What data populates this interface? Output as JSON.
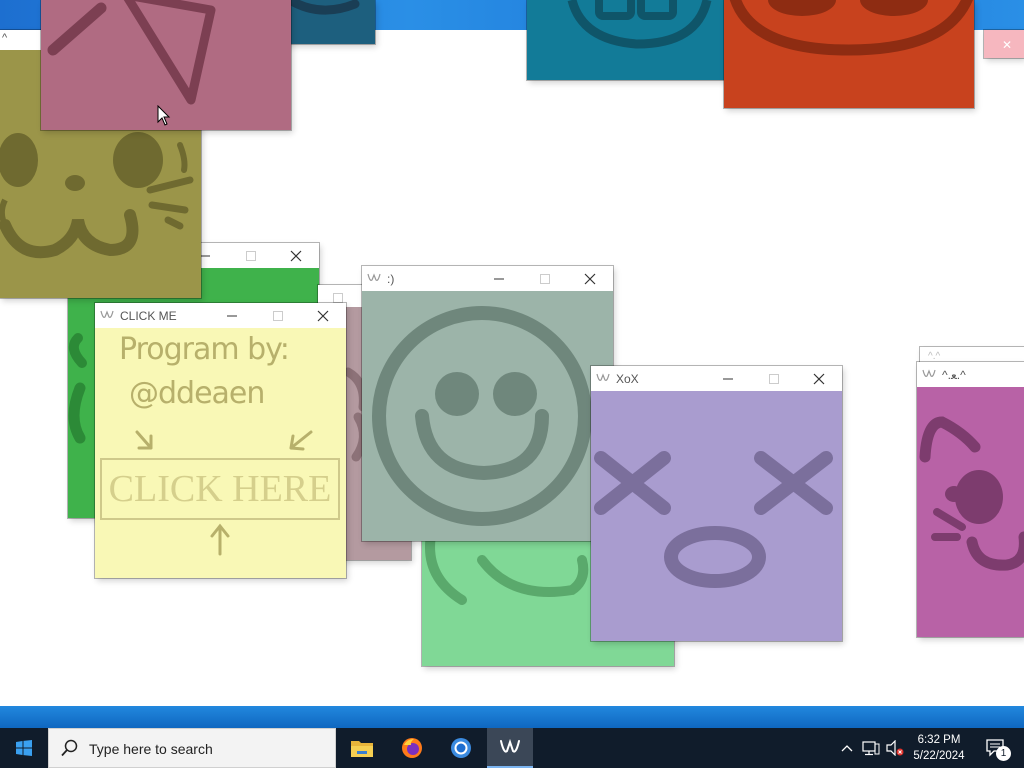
{
  "windows": {
    "click_me": {
      "title": "CLICK ME",
      "credit_line1": "Program by:",
      "credit_line2": "@ddeaen",
      "button_label": "CLICK HERE"
    },
    "smile": {
      "title": ":)"
    },
    "xox": {
      "title": "XoX"
    },
    "cat_pink": {
      "title": "^.ﻌ.^"
    }
  },
  "taskbar": {
    "search_placeholder": "Type here to search",
    "time": "6:32 PM",
    "date": "5/22/2024",
    "notification_count": "1",
    "pinned": [
      "windows-start-icon",
      "file-explorer-icon",
      "firefox-icon",
      "chrome-icon",
      "sticker-app-icon"
    ]
  },
  "colors": {
    "accent_blue": "#1d78d8",
    "taskbar_bg": "#101c2b",
    "window_yellow": "#f9f8b6",
    "window_sage": "#9cb4a9",
    "window_lavender": "#a99ccf",
    "window_olive": "#9b9549",
    "window_rose": "#b06b82",
    "window_green": "#3fb24b",
    "window_mint": "#80d896",
    "window_teal": "#127b98",
    "window_orange": "#c8421e",
    "window_magenta": "#b862a6"
  }
}
